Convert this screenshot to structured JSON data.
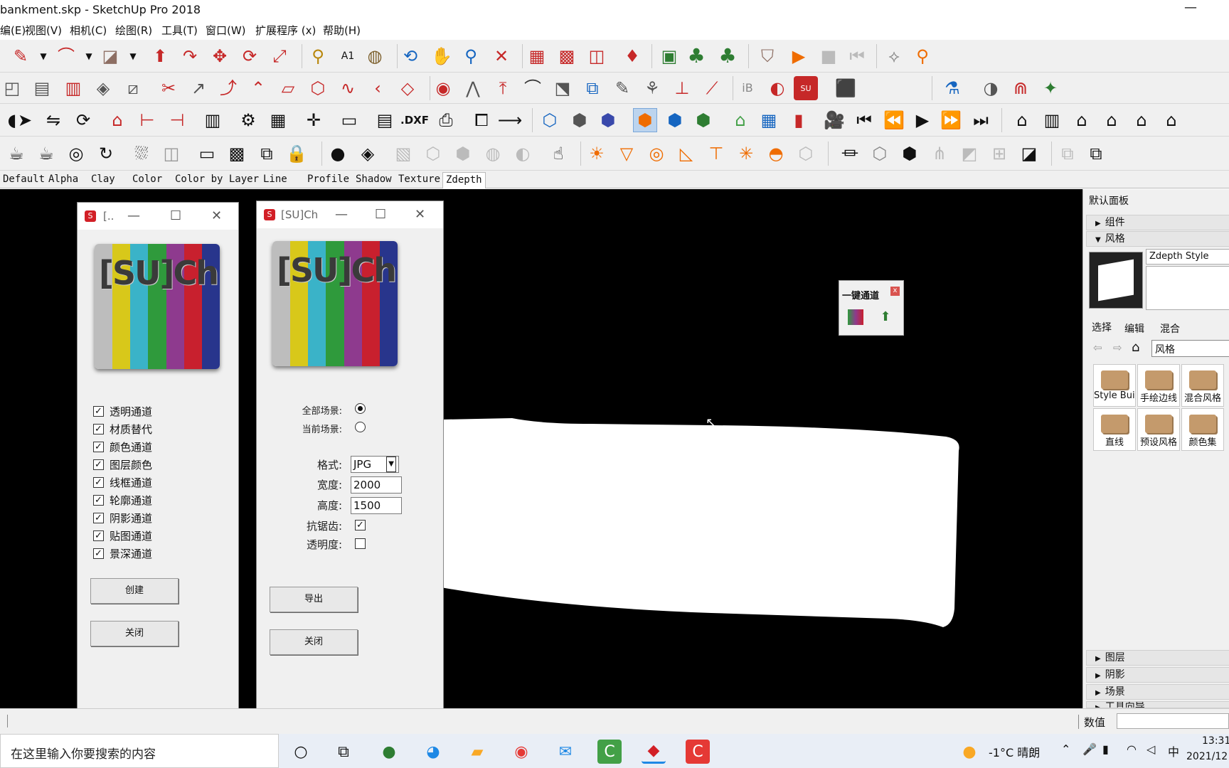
{
  "window": {
    "title": "bankment.skp - SketchUp Pro 2018",
    "minimize_icon": "—"
  },
  "menu": [
    "编(E)",
    "视图(V)",
    "相机(C)",
    "绘图(R)",
    "工具(T)",
    "窗口(W)",
    "扩展程序 (x)",
    "帮助(H)"
  ],
  "style_tabs": [
    "Default",
    "Alpha",
    "Clay",
    "Color",
    "Color by Layer",
    "Line",
    "Profile",
    "Shadow",
    "Texture",
    "Zdepth"
  ],
  "active_style_tab": "Zdepth",
  "dialog1": {
    "title": "[..",
    "logo_text": "[SU]Ch",
    "options": [
      "透明通道",
      "材质替代",
      "颜色通道",
      "图层颜色",
      "线框通道",
      "轮廓通道",
      "阴影通道",
      "贴图通道",
      "景深通道"
    ],
    "check_mark": "✓",
    "create_label": "创建",
    "close_label": "关闭"
  },
  "dialog2": {
    "title": "[SU]Ch",
    "logo_text": "[SU]Ch",
    "all_scenes_label": "全部场景:",
    "current_scene_label": "当前场景:",
    "format_label": "格式:",
    "format_value": "JPG",
    "width_label": "宽度:",
    "width_value": "2000",
    "height_label": "高度:",
    "height_value": "1500",
    "antialias_label": "抗锯齿:",
    "opacity_label": "透明度:",
    "check_mark": "✓",
    "export_label": "导出",
    "close_label": "关闭"
  },
  "window_buttons": {
    "min": "—",
    "max": "☐",
    "close": "✕"
  },
  "onekey": {
    "title": "一键通道",
    "close": "x"
  },
  "tray": {
    "title": "默认面板",
    "sections_top": [
      "组件",
      "风格"
    ],
    "style_name": "Zdepth Style",
    "tabs": [
      "选择",
      "编辑",
      "混合"
    ],
    "nav_value": "风格",
    "thumbs": [
      "Style Buil",
      "手绘边线",
      "混合风格",
      "直线",
      "预设风格",
      "颜色集"
    ],
    "sections_bottom": [
      "图层",
      "阴影",
      "场景",
      "工具向导"
    ]
  },
  "status": {
    "value_label": "数值"
  },
  "taskbar": {
    "search_placeholder": "在这里输入你要搜索的内容",
    "weather": "-1°C 晴朗",
    "ime": "中",
    "time": "13:31",
    "date": "2021/12"
  },
  "colors": {
    "logo_bars": [
      "#bdbdbd",
      "#d8c81a",
      "#3ab3c8",
      "#2f9a3c",
      "#8e3a8e",
      "#c8202e",
      "#28358c"
    ],
    "accent_red": "#d21f26"
  }
}
